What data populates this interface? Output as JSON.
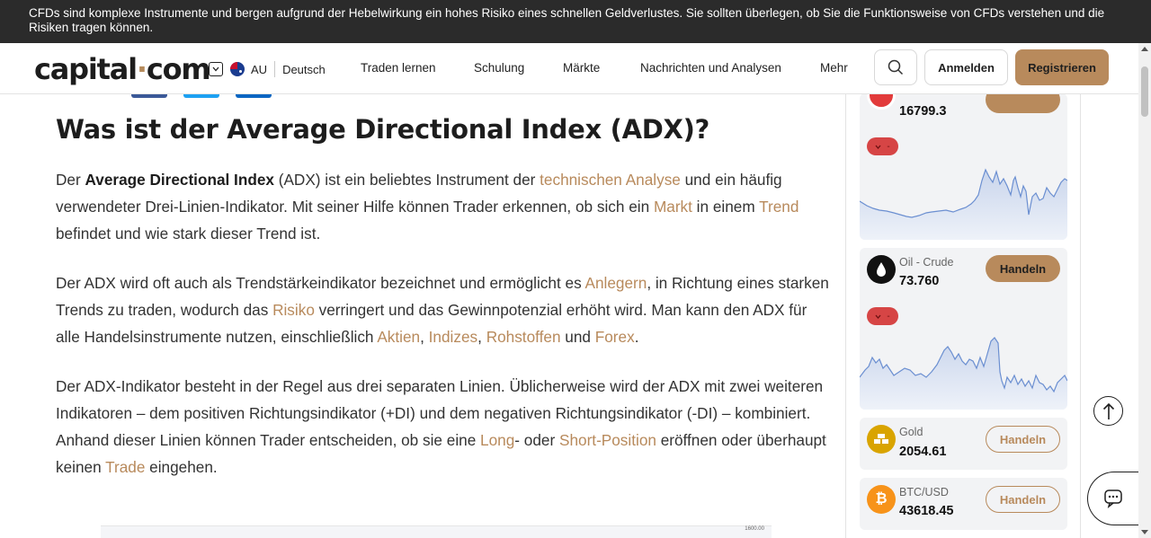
{
  "risk_banner": {
    "text": "CFDs sind komplexe Instrumente und bergen aufgrund der Hebelwirkung ein hohes Risiko eines schnellen Geldverlustes. Sie sollten überlegen, ob Sie die Funktionsweise von CFDs verstehen und die Risiken tragen können."
  },
  "header": {
    "logo_left": "capital",
    "logo_dot": "·",
    "logo_right": "com",
    "region": "AU",
    "language": "Deutsch",
    "nav": [
      "Traden lernen",
      "Schulung",
      "Märkte",
      "Nachrichten und Analysen",
      "Mehr"
    ],
    "login_label": "Anmelden",
    "register_label": "Registrieren",
    "share_colors": [
      "#3b5998",
      "#1da1f2",
      "#0a66c2"
    ]
  },
  "article": {
    "title": "Was ist der Average Directional Index (ADX)?",
    "p1": {
      "t1": "Der ",
      "b1": "Average Directional Index",
      "t2": " (ADX) ist ein beliebtes Instrument der ",
      "l1": "technischen Analyse",
      "t3": " und ein häufig verwendeter Drei-Linien-Indikator. Mit seiner Hilfe können Trader erkennen, ob sich ein ",
      "l2": "Markt",
      "t4": " in einem ",
      "l3": "Trend",
      "t5": " befindet und wie stark dieser Trend ist."
    },
    "p2": {
      "t1": "Der ADX wird oft auch als Trendstärkeindikator bezeichnet und ermöglicht es ",
      "l1": "Anlegern",
      "t2": ", in Richtung eines starken Trends zu traden, wodurch das ",
      "l2": "Risiko",
      "t3": " verringert und das Gewinnpotenzial erhöht wird. Man kann den ADX für alle Handelsinstrumente nutzen, einschließlich ",
      "l3": "Aktien",
      "t4": ", ",
      "l4": "Indizes",
      "t5": ", ",
      "l5": "Rohstoffen",
      "t6": " und ",
      "l6": "Forex",
      "t7": "."
    },
    "p3": {
      "t1": "Der ADX-Indikator besteht in der Regel aus drei separaten Linien. Üblicherweise wird der ADX mit zwei weiteren Indikatoren – dem positiven Richtungsindikator (+DI) und dem negativen Richtungsindikator (-DI) – kombiniert. Anhand dieser Linien können Trader entscheiden, ob sie eine ",
      "l1": "Long",
      "t2": "- oder ",
      "l2": "Short-Position",
      "t3": " eröffnen oder überhaupt keinen ",
      "l3": "Trade",
      "t4": " eingehen."
    },
    "chart_peek_label": "1600.00"
  },
  "sidebar": {
    "cards": [
      {
        "name": "",
        "price": "16799.3",
        "badge": "-",
        "has_chart": true
      },
      {
        "name": "Oil - Crude",
        "price": "73.760",
        "button": "Handeln",
        "badge": "-",
        "has_chart": true,
        "icon": "oil-drop-icon"
      },
      {
        "name": "Gold",
        "price": "2054.61",
        "button": "Handeln",
        "icon": "gold-bars-icon"
      },
      {
        "name": "BTC/USD",
        "price": "43618.45",
        "button": "Handeln",
        "icon": "bitcoin-icon",
        "icon_glyph": "₿"
      }
    ]
  }
}
